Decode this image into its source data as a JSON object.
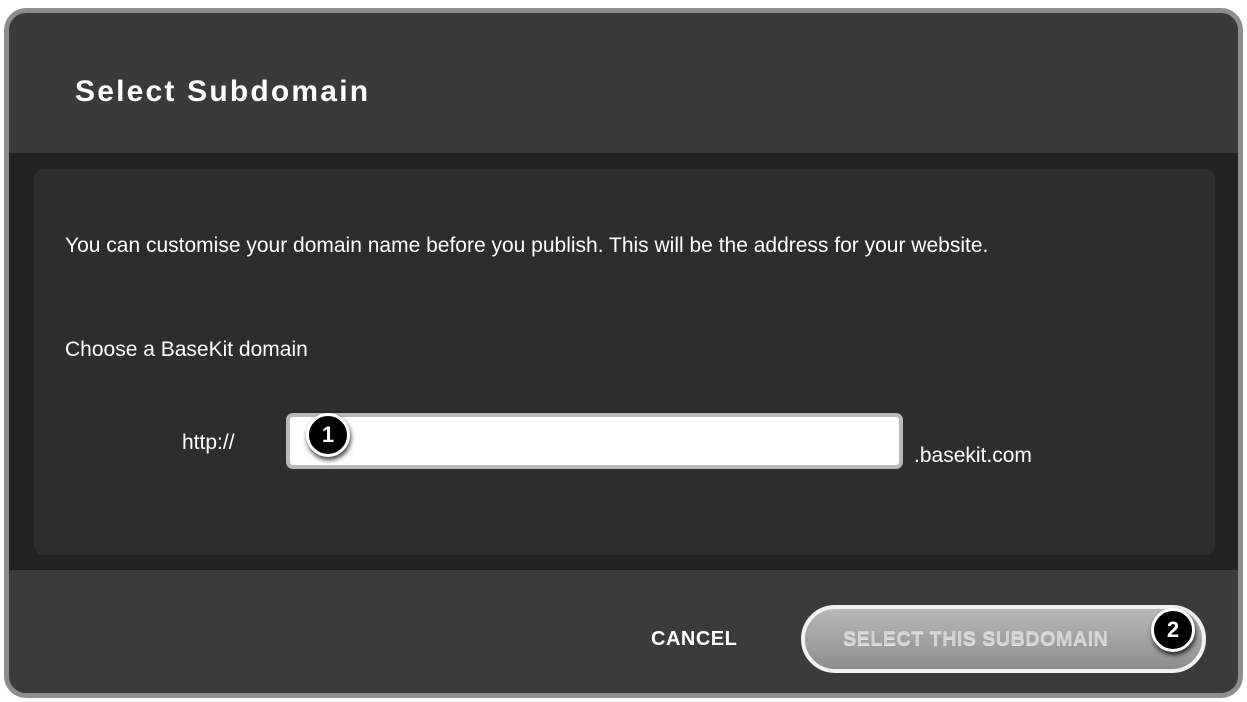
{
  "dialog": {
    "title": "Select Subdomain",
    "intro_text": "You can customise your domain name before you publish. This will be the address for your website.",
    "choose_label": "Choose a BaseKit domain",
    "subdomain": {
      "prefix": "http://",
      "value": "",
      "placeholder": "",
      "suffix": ".basekit.com"
    },
    "footer": {
      "cancel_label": "CANCEL",
      "select_label": "SELECT THIS SUBDOMAIN"
    }
  },
  "annotations": {
    "marker_1": "1",
    "marker_2": "2"
  },
  "colors": {
    "dialog_background": "#3b3b3b",
    "body_band": "#222222",
    "content_panel": "#2d2d2d",
    "frame_border": "#8d8d8d",
    "select_button_disabled": "#a3a3a3"
  }
}
